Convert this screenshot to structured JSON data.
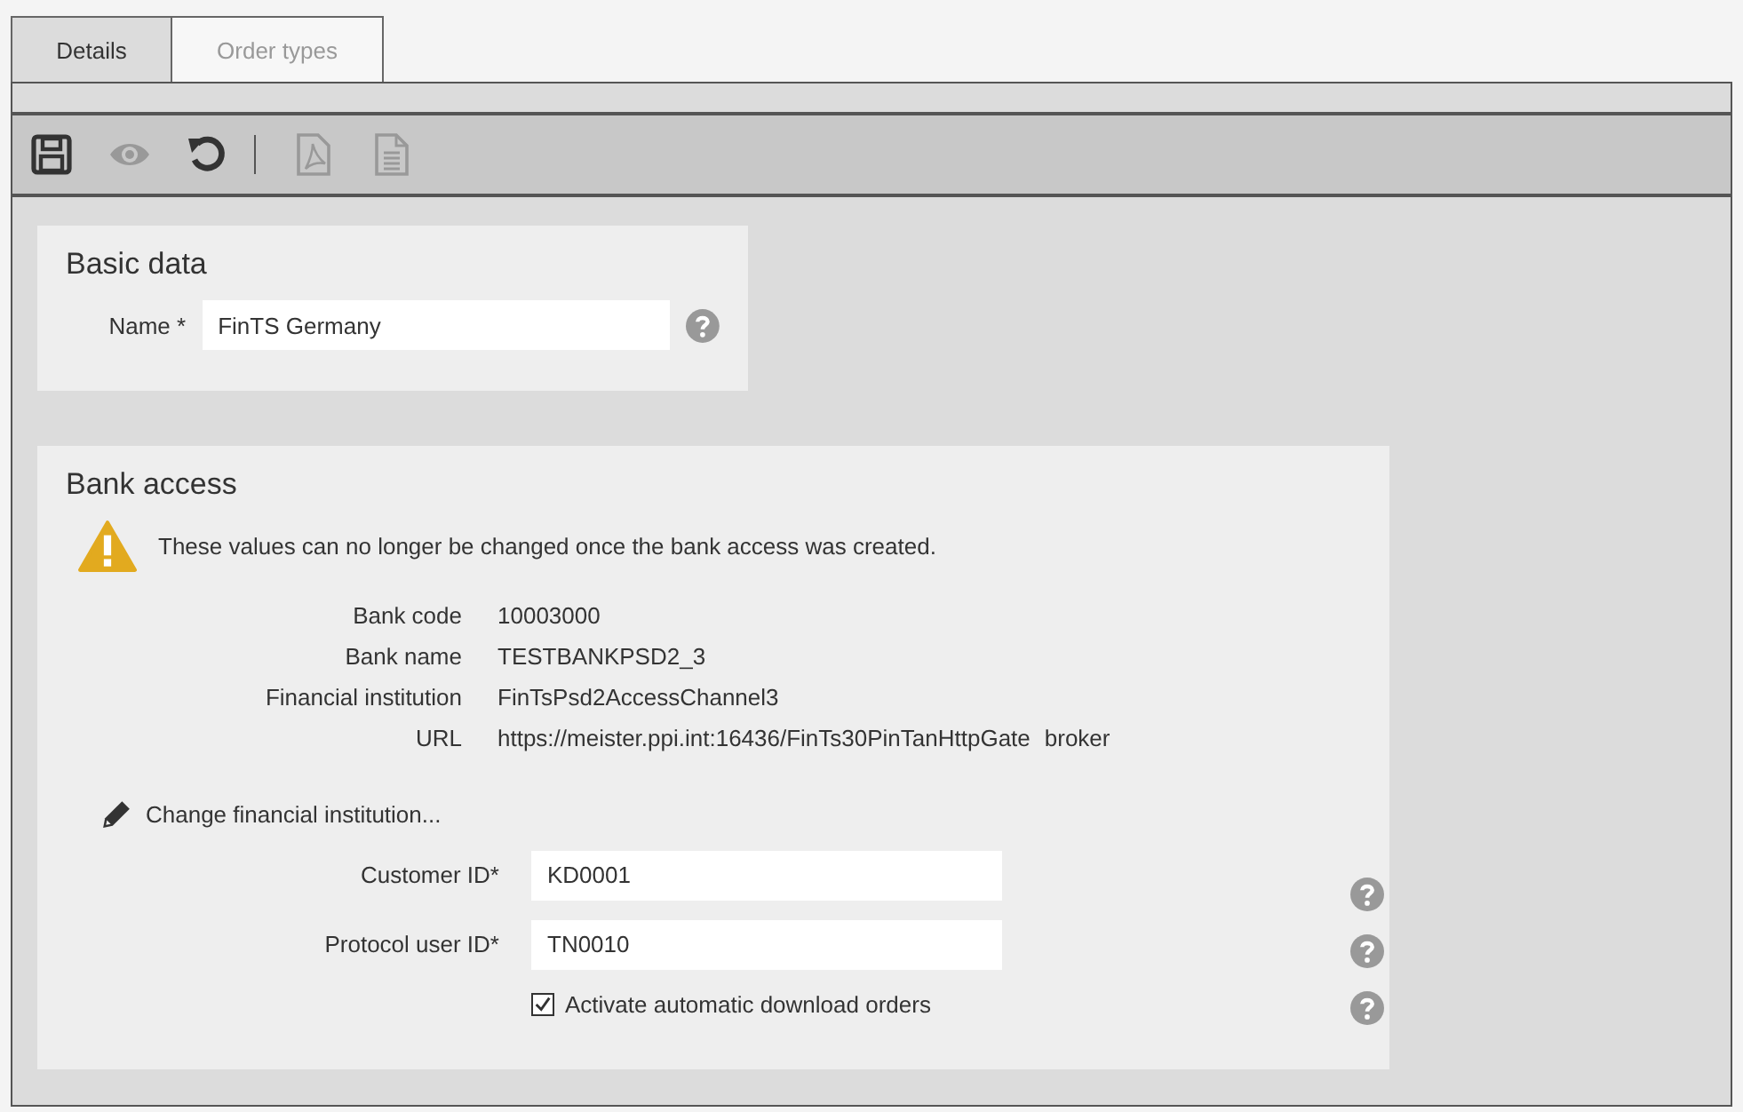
{
  "tabs": [
    {
      "label": "Details",
      "selected": true
    },
    {
      "label": "Order types",
      "selected": false
    }
  ],
  "toolbar": [
    {
      "kind": "save",
      "disabled": false
    },
    {
      "kind": "preview",
      "disabled": true
    },
    {
      "kind": "undo",
      "disabled": false
    },
    {
      "kind": "separator"
    },
    {
      "kind": "pdf",
      "disabled": true
    },
    {
      "kind": "document",
      "disabled": true
    }
  ],
  "basic_data": {
    "title": "Basic data",
    "name_label": "Name *",
    "name_value": "FinTS Germany"
  },
  "bank_access": {
    "title": "Bank access",
    "warning": "These values can no longer be changed once the bank access was created.",
    "details": [
      {
        "label": "Bank code",
        "value": "10003000"
      },
      {
        "label": "Bank name",
        "value": "TESTBANKPSD2_3"
      },
      {
        "label": "Financial institution",
        "value": "FinTsPsd2AccessChannel3"
      },
      {
        "label": "URL",
        "value": "https://meister.ppi.int:16436/FinTs30PinTanHttpGate",
        "extra": "broker"
      }
    ],
    "change_link": "Change financial institution...",
    "fields": [
      {
        "label": "Customer ID*",
        "value": "KD0001"
      },
      {
        "label": "Protocol user ID*",
        "value": "TN0010"
      }
    ],
    "checkbox": {
      "label": "Activate automatic download orders",
      "checked": true
    }
  }
}
